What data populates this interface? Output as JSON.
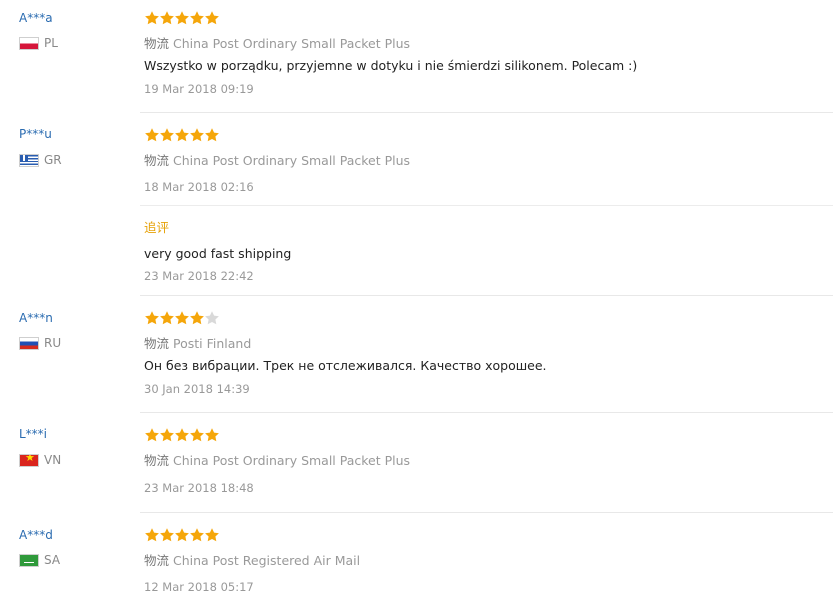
{
  "logistics_label": "物流",
  "followup_label": "追评",
  "reviews": [
    {
      "user": "A***a",
      "country": "PL",
      "rating": 5,
      "shipping": "China Post Ordinary Small Packet Plus",
      "text": "Wszystko w porządku, przyjemne w dotyku i nie śmierdzi silikonem. Polecam :)",
      "date": "19 Mar 2018 09:19"
    },
    {
      "user": "P***u",
      "country": "GR",
      "rating": 5,
      "shipping": "China Post Ordinary Small Packet Plus",
      "text": "",
      "date": "18 Mar 2018 02:16",
      "followup_text": "very good fast shipping",
      "followup_date": "23 Mar 2018 22:42"
    },
    {
      "user": "A***n",
      "country": "RU",
      "rating": 4,
      "shipping": "Posti Finland",
      "text": "Он без вибрации. Трек не отслеживался. Качество хорошее.",
      "date": "30 Jan 2018 14:39"
    },
    {
      "user": "L***i",
      "country": "VN",
      "rating": 5,
      "shipping": "China Post Ordinary Small Packet Plus",
      "text": "",
      "date": "23 Mar 2018 18:48"
    },
    {
      "user": "A***d",
      "country": "SA",
      "rating": 5,
      "shipping": "China Post Registered Air Mail",
      "text": "",
      "date": "12 Mar 2018 05:17"
    }
  ],
  "colors": {
    "star_filled": "#f5a60a",
    "star_empty": "#d9d9d9",
    "username": "#2a6bb0",
    "followup": "#e6a20a"
  }
}
